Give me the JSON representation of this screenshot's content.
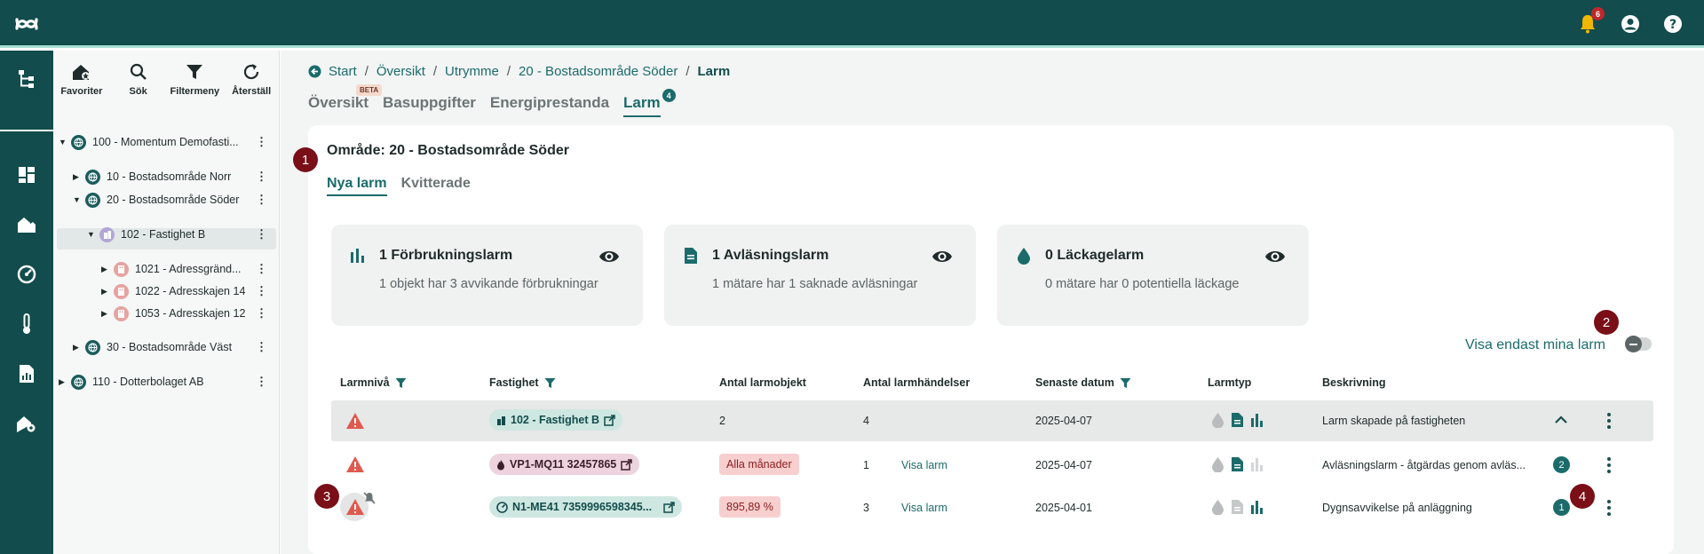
{
  "topbar": {
    "notification_count": "6"
  },
  "tree": {
    "tools": [
      {
        "label": "Favoriter"
      },
      {
        "label": "Sök"
      },
      {
        "label": "Filtermeny"
      },
      {
        "label": "Återställ"
      }
    ],
    "nodes": [
      {
        "label": "100 - Momentum Demofasti..."
      },
      {
        "label": "10 - Bostadsområde Norr"
      },
      {
        "label": "20 - Bostadsområde Söder"
      },
      {
        "label": "102 - Fastighet B"
      },
      {
        "label": "1021 - Adressgränd..."
      },
      {
        "label": "1022 - Adresskajen 14"
      },
      {
        "label": "1053 - Adresskajen 12"
      },
      {
        "label": "30 - Bostadsområde Väst"
      },
      {
        "label": "110 - Dotterbolaget AB"
      }
    ]
  },
  "breadcrumb": [
    "Start",
    "Översikt",
    "Utrymme",
    "20 - Bostadsområde Söder",
    "Larm"
  ],
  "tabs": {
    "items": [
      "Översikt",
      "Basuppgifter",
      "Energiprestanda",
      "Larm"
    ],
    "beta_label": "BETA",
    "larm_count": "4"
  },
  "steps": [
    "1",
    "2",
    "3",
    "4"
  ],
  "area_title": "Område: 20 - Bostadsområde Söder",
  "subtabs": [
    "Nya larm",
    "Kvitterade"
  ],
  "summary": [
    {
      "title": "1 Förbrukningslarm",
      "desc": "1 objekt har 3 avvikande förbrukningar"
    },
    {
      "title": "1 Avläsningslarm",
      "desc": "1 mätare har 1 saknade avläsningar"
    },
    {
      "title": "0 Läckagelarm",
      "desc": "0 mätare har 0 potentiella läckage"
    }
  ],
  "mine_toggle_label": "Visa endast mina larm",
  "table": {
    "headers": [
      "Larmnivå",
      "Fastighet",
      "Antal larmobjekt",
      "Antal larmhändelser",
      "Senaste datum",
      "Larmtyp",
      "Beskrivning"
    ],
    "rows": [
      {
        "fastighet": "102 - Fastighet B",
        "objekt": "2",
        "handelser": "4",
        "datum": "2025-04-07",
        "beskrivning": "Larm skapade på fastigheten"
      },
      {
        "fastighet": "VP1-MQ11 32457865",
        "objekt": "Alla månader",
        "handelser": "1",
        "link": "Visa larm",
        "datum": "2025-04-07",
        "beskrivning": "Avläsningslarm - åtgärdas genom avläs...",
        "count": "2"
      },
      {
        "fastighet": "N1-ME41 7359996598345...",
        "objekt": "895,89 %",
        "handelser": "3",
        "link": "Visa larm",
        "datum": "2025-04-01",
        "beskrivning": "Dygnsavvikelse på anläggning",
        "count": "1"
      }
    ]
  },
  "colors": {
    "brand": "#124c4c",
    "accent": "#1b6b6b",
    "alarm": "#e05a4f",
    "step": "#7a0f17"
  }
}
